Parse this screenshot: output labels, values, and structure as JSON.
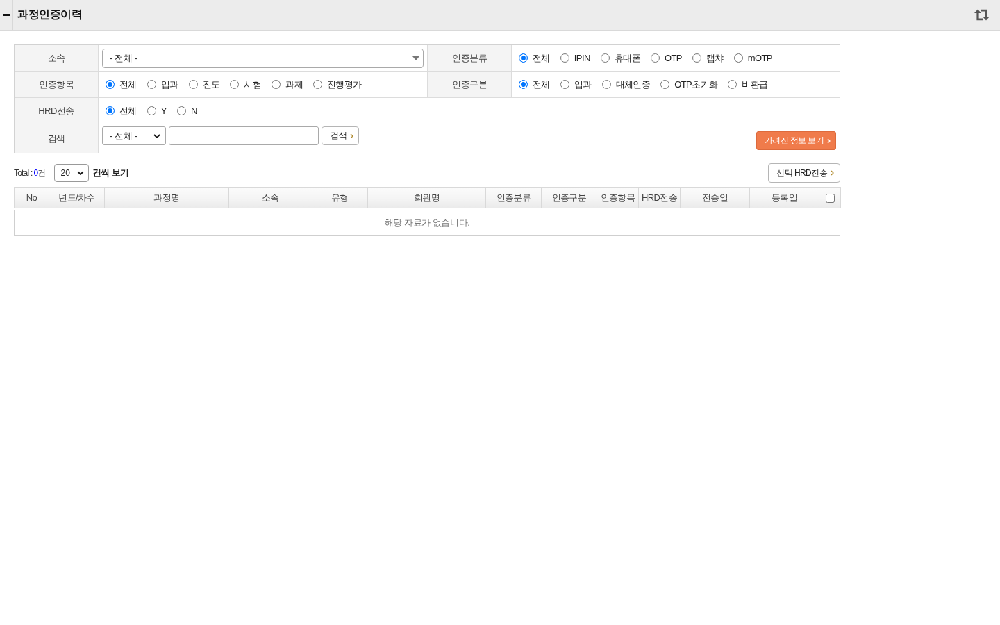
{
  "header": {
    "title": "과정인증이력"
  },
  "filters": [
    {
      "fields": [
        {
          "kind": "select",
          "label": "소속",
          "value": "- 전체 -"
        },
        {
          "kind": "radio",
          "label": "인증분류",
          "options": [
            {
              "label": "전체",
              "selected": true
            },
            {
              "label": "IPIN",
              "selected": false
            },
            {
              "label": "휴대폰",
              "selected": false
            },
            {
              "label": "OTP",
              "selected": false
            },
            {
              "label": "캡챠",
              "selected": false
            },
            {
              "label": "mOTP",
              "selected": false
            }
          ]
        }
      ]
    },
    {
      "fields": [
        {
          "kind": "radio",
          "label": "인증항목",
          "options": [
            {
              "label": "전체",
              "selected": true
            },
            {
              "label": "입과",
              "selected": false
            },
            {
              "label": "진도",
              "selected": false
            },
            {
              "label": "시험",
              "selected": false
            },
            {
              "label": "과제",
              "selected": false
            },
            {
              "label": "진행평가",
              "selected": false
            }
          ]
        },
        {
          "kind": "radio",
          "label": "인증구분",
          "options": [
            {
              "label": "전체",
              "selected": true
            },
            {
              "label": "입과",
              "selected": false
            },
            {
              "label": "대체인증",
              "selected": false
            },
            {
              "label": "OTP초기화",
              "selected": false
            },
            {
              "label": "비환급",
              "selected": false
            }
          ]
        }
      ]
    },
    {
      "fields": [
        {
          "kind": "radio",
          "label": "HRD전송",
          "options": [
            {
              "label": "전체",
              "selected": true
            },
            {
              "label": "Y",
              "selected": false
            },
            {
              "label": "N",
              "selected": false
            }
          ]
        }
      ]
    },
    {
      "fields": [
        {
          "kind": "search",
          "label": "검색",
          "select": "- 전체 -",
          "button": "검색"
        }
      ],
      "action_button": "가려진 정보 보기"
    }
  ],
  "list_toolbar": {
    "total_label": "Total :",
    "total_count": "0",
    "total_unit": "건",
    "page_size": "20",
    "page_size_suffix": "건씩 보기",
    "send_button": "선택 HRD전송"
  },
  "table": {
    "columns": [
      {
        "kind": "text",
        "label": "No"
      },
      {
        "kind": "text",
        "label": "년도/차수"
      },
      {
        "kind": "text",
        "label": "과정명"
      },
      {
        "kind": "text",
        "label": "소속"
      },
      {
        "kind": "text",
        "label": "유형"
      },
      {
        "kind": "text",
        "label": "회원명"
      },
      {
        "kind": "text",
        "label": "인증분류"
      },
      {
        "kind": "text",
        "label": "인증구분"
      },
      {
        "kind": "text",
        "label": "인증항목"
      },
      {
        "kind": "text",
        "label": "HRD전송"
      },
      {
        "kind": "text",
        "label": "전송일"
      },
      {
        "kind": "text",
        "label": "등록일"
      },
      {
        "kind": "checkbox",
        "checked": false
      }
    ],
    "empty_message": "해당 자료가 없습니다."
  }
}
